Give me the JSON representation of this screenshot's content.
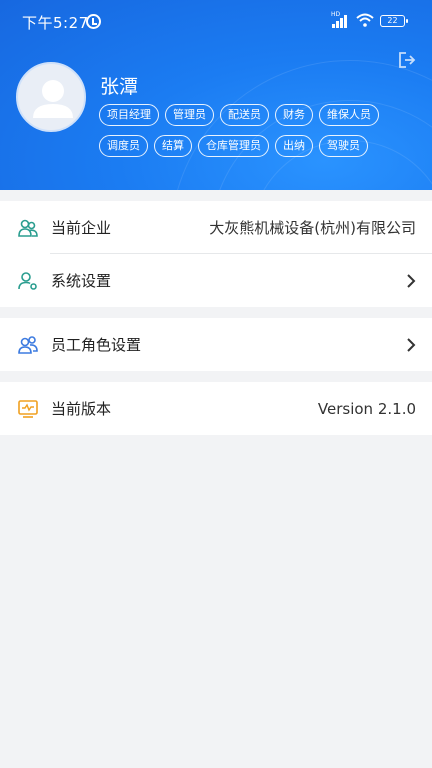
{
  "status_bar": {
    "time": "下午5:27",
    "network": "HD",
    "battery": "22"
  },
  "profile": {
    "name": "张潭",
    "roles": [
      "项目经理",
      "管理员",
      "配送员",
      "财务",
      "维保人员",
      "调度员",
      "结算",
      "仓库管理员",
      "出纳",
      "驾驶员"
    ]
  },
  "menu": {
    "company": {
      "label": "当前企业",
      "value": "大灰熊机械设备(杭州)有限公司"
    },
    "settings": {
      "label": "系统设置"
    },
    "roles": {
      "label": "员工角色设置"
    },
    "version": {
      "label": "当前版本",
      "value": "Version 2.1.0"
    }
  },
  "colors": {
    "header": "#1b7cf2",
    "icon_teal": "#2a9d8f",
    "icon_blue": "#3d7be0",
    "icon_orange": "#f0a020",
    "background": "#f2f3f5"
  }
}
